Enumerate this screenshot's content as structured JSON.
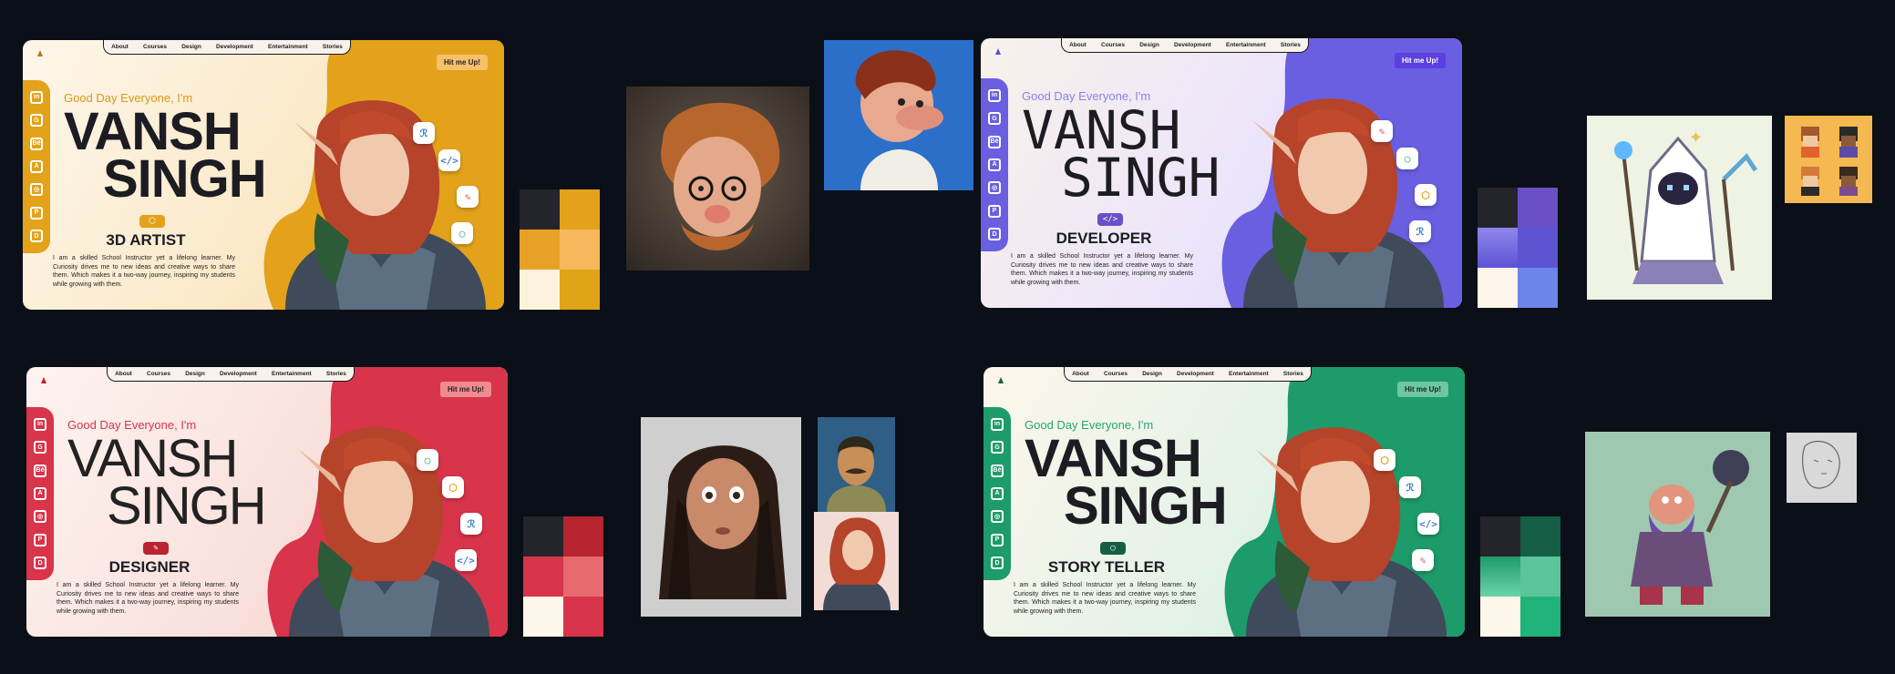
{
  "nav": [
    "About",
    "Courses",
    "Design",
    "Development",
    "Entertainment",
    "Stories"
  ],
  "cta": "Hit me Up!",
  "greeting": "Good Day Everyone, I'm",
  "first": "VANSH",
  "last": "SINGH",
  "description": "I am a skilled School Instructor yet a lifelong learner. My Curiosity drives me to new ideas and creative ways to share them. Which makes it a two-way journey, inspiring my students while growing with them.",
  "social_icons": [
    "linkedin-icon",
    "github-icon",
    "behance-icon",
    "artstation-icon",
    "instagram-icon",
    "pinterest-icon",
    "discord-icon"
  ],
  "cards": [
    {
      "role": "3D ARTIST",
      "accent": "#e3a21a",
      "bg": "#fbf0d9",
      "greet_color": "#d99a12"
    },
    {
      "role": "DEVELOPER",
      "accent": "#6a5fe0",
      "bg": "#f1ecfb",
      "greet_color": "#8b7ff0"
    },
    {
      "role": "DESIGNER",
      "accent": "#d8344a",
      "bg": "#fbece9",
      "greet_color": "#d8344a"
    },
    {
      "role": "STORY TELLER",
      "accent": "#1d9b6a",
      "bg": "#eef7f1",
      "greet_color": "#27a474"
    }
  ],
  "palettes": [
    [
      "#24242b",
      "#e3a21a",
      "#e3a21a",
      "#f7b85b",
      "#fdf3dc",
      "#e0a417"
    ],
    [
      "#24242b",
      "#6a4fc6",
      "#6b5fd8",
      "#5c55cf",
      "#fdf6ea",
      "#6d84ea"
    ],
    [
      "#24242b",
      "#b8242f",
      "#d8344a",
      "#e66a6e",
      "#fdf6ea",
      "#d8344a"
    ],
    [
      "#24242b",
      "#145e45",
      "#1d9b6a",
      "#5bc49b",
      "#fdf6ea",
      "#20b37a"
    ]
  ]
}
